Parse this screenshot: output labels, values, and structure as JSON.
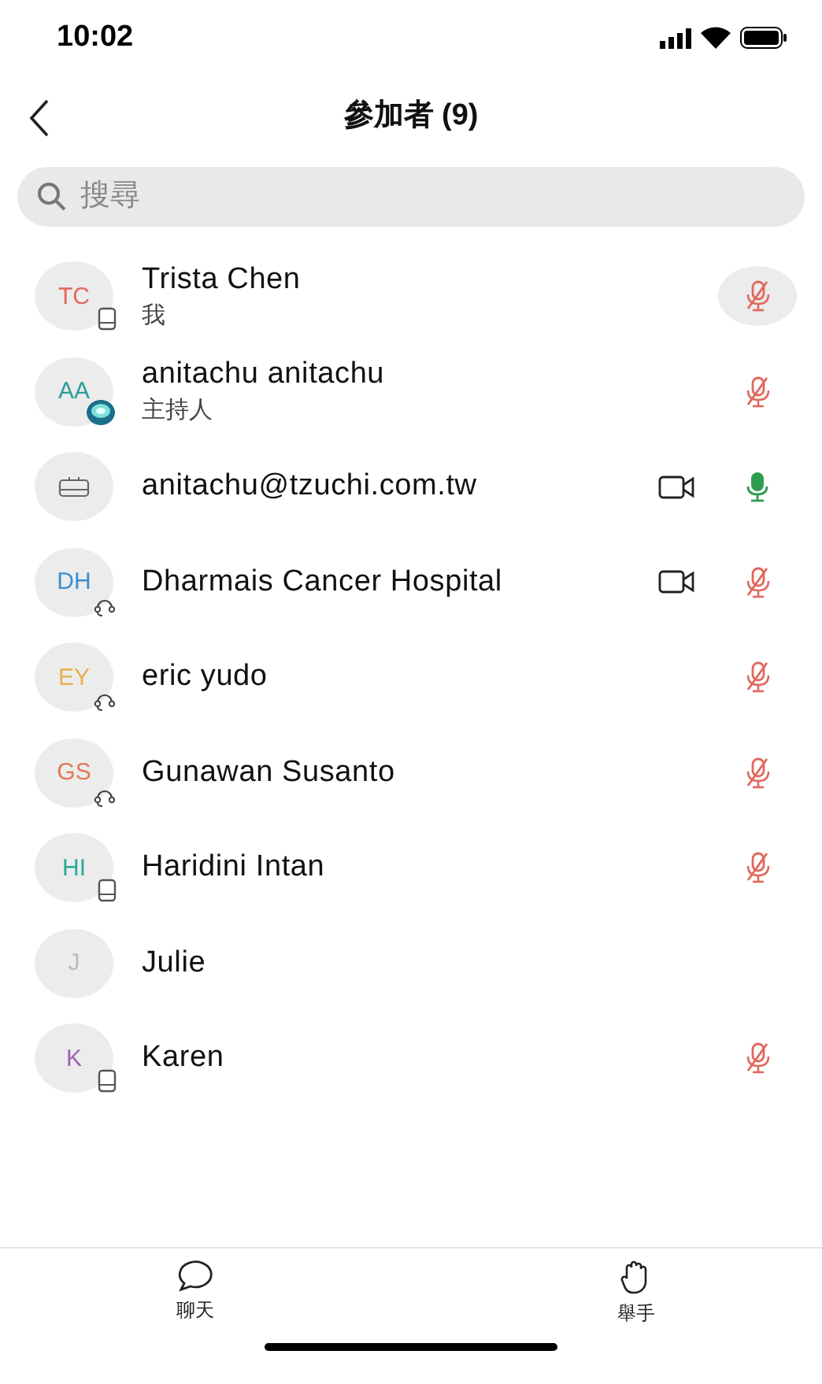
{
  "status_bar": {
    "time": "10:02"
  },
  "header": {
    "title": "參加者 (9)"
  },
  "search": {
    "placeholder": "搜尋"
  },
  "participants": [
    {
      "initials": "TC",
      "color": "#e0685c",
      "badge": {
        "kind": "phone"
      },
      "name": "Trista Chen",
      "subtitle": "我",
      "video": false,
      "mic": {
        "kind": "muted"
      },
      "selected": true
    },
    {
      "initials": "AA",
      "color": "#2a9d9d",
      "badge": {
        "kind": "host"
      },
      "name": "anitachu anitachu",
      "subtitle": "主持人",
      "video": false,
      "mic": {
        "kind": "muted"
      },
      "selected": false
    },
    {
      "badge": {
        "kind": "room"
      },
      "name": "anitachu@tzuchi.com.tw",
      "video": true,
      "mic": {
        "kind": "on"
      },
      "selected": false
    },
    {
      "initials": "DH",
      "color": "#3b8fd0",
      "badge": {
        "kind": "headset"
      },
      "name": "Dharmais Cancer Hospital",
      "video": true,
      "mic": {
        "kind": "muted"
      },
      "selected": false
    },
    {
      "initials": "EY",
      "color": "#e8b04a",
      "badge": {
        "kind": "headset"
      },
      "name": "eric yudo",
      "video": false,
      "mic": {
        "kind": "muted"
      },
      "selected": false
    },
    {
      "initials": "GS",
      "color": "#e07a55",
      "badge": {
        "kind": "headset"
      },
      "name": "Gunawan Susanto",
      "video": false,
      "mic": {
        "kind": "muted"
      },
      "selected": false
    },
    {
      "initials": "HI",
      "color": "#2aa89a",
      "badge": {
        "kind": "phone"
      },
      "name": "Haridini Intan",
      "video": false,
      "mic": {
        "kind": "muted"
      },
      "selected": false
    },
    {
      "initials": "J",
      "color": "#bbbbbb",
      "name": "Julie",
      "video": false,
      "selected": false
    },
    {
      "initials": "K",
      "color": "#a45fb5",
      "badge": {
        "kind": "phone"
      },
      "name": "Karen",
      "video": false,
      "mic": {
        "kind": "muted"
      },
      "selected": false
    }
  ],
  "tab_bar": [
    {
      "kind": "chat",
      "label": "聊天"
    },
    {
      "kind": "raise_hand",
      "label": "舉手"
    }
  ]
}
